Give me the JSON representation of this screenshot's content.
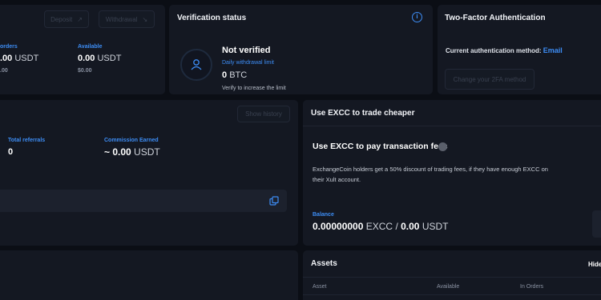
{
  "balance_panel": {
    "deposit_label": "Deposit",
    "withdrawal_label": "Withdrawal",
    "orders_label": "orders",
    "orders_value": ".00",
    "orders_unit": "USDT",
    "orders_sub": ".00",
    "available_label": "Available",
    "available_value": "0.00",
    "available_unit": "USDT",
    "available_sub": "$0.00"
  },
  "verification": {
    "title": "Verification status",
    "status": "Not verified",
    "limit_label": "Daily withdrawal limit",
    "limit_value": "0",
    "limit_unit": "BTC",
    "hint": "Verify to increase the limit"
  },
  "two_factor": {
    "title": "Two-Factor Authentication",
    "method_label": "Current authentication method:",
    "method_value": "Email",
    "change_button": "Change your 2FA method"
  },
  "referral": {
    "show_history": "Show history",
    "total_referrals_label": "Total referrals",
    "total_referrals_value": "0",
    "commission_label": "Commission Earned",
    "commission_value": "~ 0.00",
    "commission_unit": "USDT"
  },
  "excc": {
    "title": "Use EXCC to trade cheaper",
    "toggle_label": "Use EXCC to pay transaction fees",
    "description": "ExchangeCoin holders get a 50% discount of trading fees, if they have enough EXCC on their Xult account.",
    "balance_label": "Balance",
    "excc_value": "0.00000000",
    "excc_unit": "EXCC",
    "separator": "/",
    "usdt_value": "0.00",
    "usdt_unit": "USDT"
  },
  "assets": {
    "title": "Assets",
    "hide_label": "Hide",
    "columns": [
      "Asset",
      "Available",
      "In Orders"
    ]
  },
  "colors": {
    "accent": "#3d8df5",
    "panel": "#141822",
    "background": "#0b0e15"
  }
}
